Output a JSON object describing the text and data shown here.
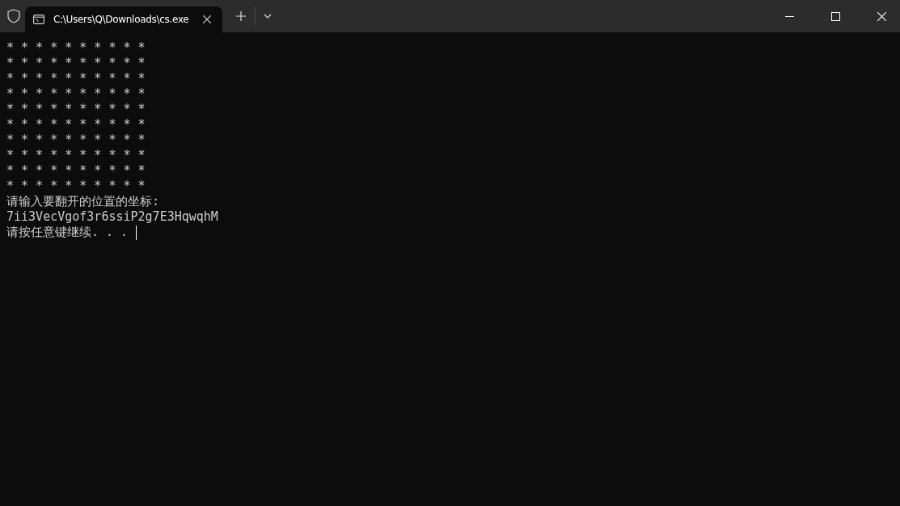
{
  "tabs": [
    {
      "label": "C:\\Users\\Q\\Downloads\\cs.exe",
      "selected": true
    }
  ],
  "terminal": {
    "lines": [
      "* * * * * * * * * *",
      "* * * * * * * * * *",
      "* * * * * * * * * *",
      "* * * * * * * * * *",
      "* * * * * * * * * *",
      "* * * * * * * * * *",
      "* * * * * * * * * *",
      "* * * * * * * * * *",
      "* * * * * * * * * *",
      "* * * * * * * * * *",
      "请输入要翻开的位置的坐标:",
      "7ii3VecVgof3r6ssiP2g7E3HqwqhM",
      "请按任意键继续. . ."
    ],
    "cursor": true
  }
}
